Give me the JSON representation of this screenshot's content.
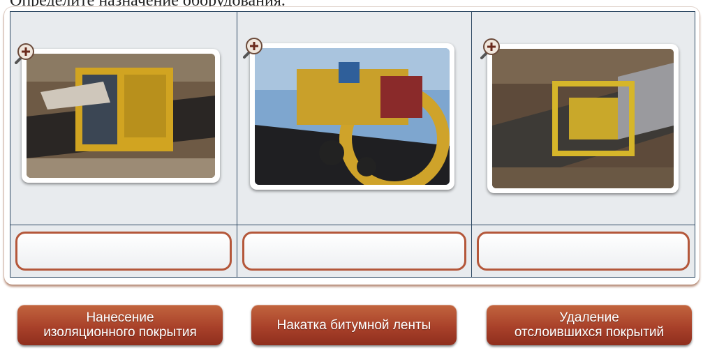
{
  "header": {
    "title": "Определите назначение оборудования."
  },
  "photos": [
    {
      "zoom_icon": "zoom-in-icon",
      "subject": "pipe-insulation-machine"
    },
    {
      "zoom_icon": "zoom-in-icon",
      "subject": "bitumen-tape-wrapping-machine"
    },
    {
      "zoom_icon": "zoom-in-icon",
      "subject": "coating-removal-machine"
    }
  ],
  "answer_buttons": [
    {
      "line1": "Нанесение",
      "line2": "изоляционного покрытия"
    },
    {
      "line1": "Накатка битумной ленты",
      "line2": ""
    },
    {
      "line1": "Удаление",
      "line2": "отслоившихся покрытий"
    }
  ],
  "colors": {
    "accent": "#a9412a",
    "grid_line": "#2f4a64",
    "slot_border": "#b4573a"
  }
}
